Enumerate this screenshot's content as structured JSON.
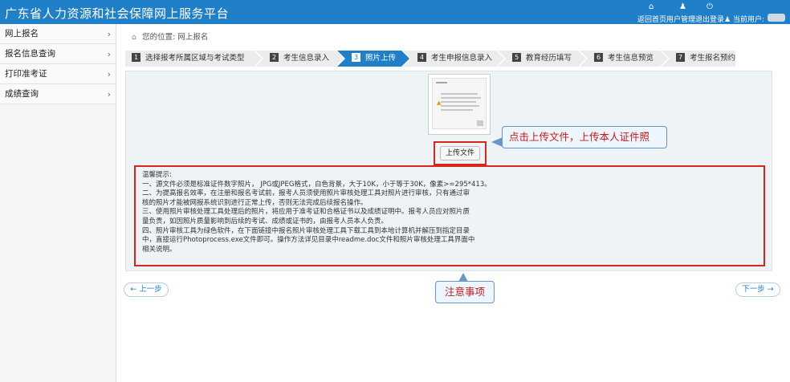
{
  "header": {
    "title": "广东省人力资源和社会保障网上服务平台",
    "links": [
      "返回首页",
      "用户管理",
      "退出登录"
    ],
    "current_user_label": "当前用户:",
    "icons": [
      "home-icon",
      "user-icon",
      "power-icon"
    ]
  },
  "sidebar": {
    "items": [
      {
        "label": "网上报名"
      },
      {
        "label": "报名信息查询"
      },
      {
        "label": "打印准考证"
      },
      {
        "label": "成绩查询"
      }
    ]
  },
  "breadcrumb": {
    "prefix": "您的位置:",
    "current": "网上报名"
  },
  "steps": [
    {
      "num": "1",
      "label": "选择报考所属区域与考试类型",
      "active": false
    },
    {
      "num": "2",
      "label": "考生信息录入",
      "active": false
    },
    {
      "num": "3",
      "label": "照片上传",
      "active": true
    },
    {
      "num": "4",
      "label": "考生申报信息录入",
      "active": false
    },
    {
      "num": "5",
      "label": "教育经历填写",
      "active": false
    },
    {
      "num": "6",
      "label": "考生信息预览",
      "active": false
    },
    {
      "num": "7",
      "label": "考生报名预约",
      "active": false
    }
  ],
  "upload": {
    "button_label": "上传文件"
  },
  "annotations": {
    "upload_hint": "点击上传文件，上传本人证件照",
    "notice_hint": "注意事项"
  },
  "notice": {
    "lines": [
      "温馨提示:",
      "一、源文件必须是标准证件数字照片， JPG或JPEG格式，白色背景，大于10K，小于等于30K，像素>=295*413。",
      "二、为提高报名效率，在注册和报名考试前，报考人员须使用照片审核处理工具对照片进行审核，只有通过审",
      "核的照片才能被网报系统识别进行正常上传，否则无法完成后续报名操作。",
      "三、使用照片审核处理工具处理后的照片，将应用于准考证和合格证书以及成绩证明中。报考人员应对照片质",
      "量负责，如因照片质量影响到后续的考试、成绩或证书的，由报考人员本人负责。",
      "四、照片审核工具为绿色软件，在下面链接中报名照片审核处理工具下载工具到本地计算机并解压到指定目录",
      "中，直接运行Photoprocess.exe文件即可。操作方法详见目录中readme.doc文件和照片审核处理工具界面中",
      "相关说明。"
    ]
  },
  "nav": {
    "prev_label": "← 上一步",
    "next_label": "下一步 →"
  },
  "colors": {
    "header_bg": "#1f7fc8",
    "highlight_red": "#d9261c",
    "callout_text": "#c41a1a"
  }
}
